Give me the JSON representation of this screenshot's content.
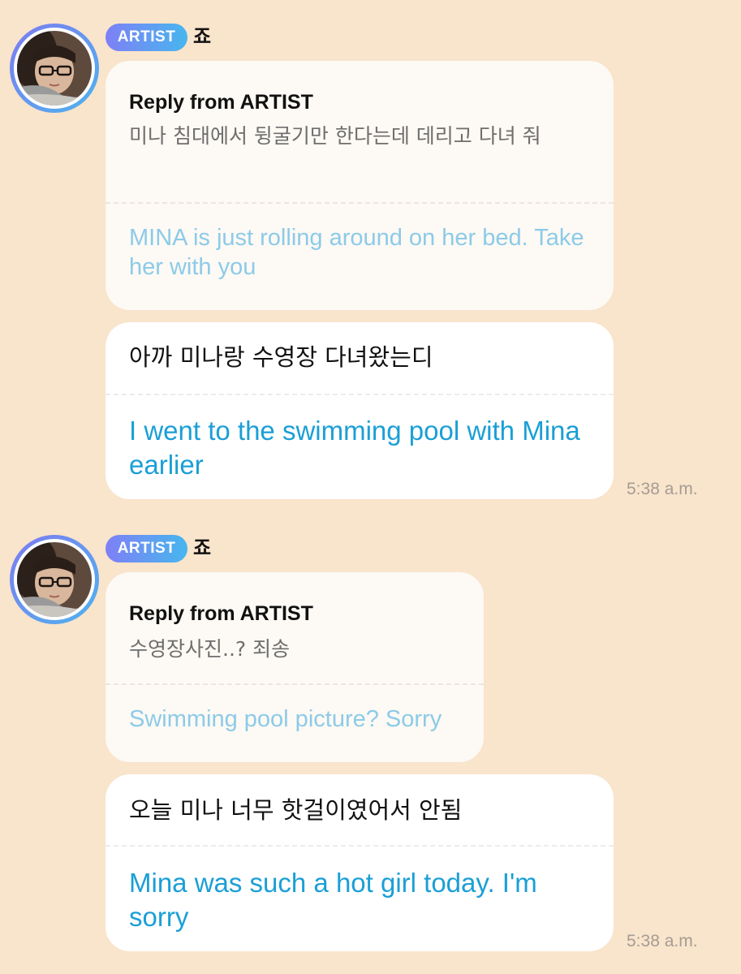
{
  "conversation": [
    {
      "badge": "ARTIST",
      "name": "죠",
      "avatar": "profile-photo",
      "reply": {
        "title": "Reply from ARTIST",
        "original": "미나 침대에서 뒹굴기만 한다는데 데리고 다녀 줘",
        "translation": "MINA is just rolling around on her bed. Take her with you"
      },
      "message": {
        "original": "아까 미나랑 수영장 다녀왔는디",
        "translation": "I went to the swimming pool with Mina earlier"
      },
      "time": "5:38 a.m."
    },
    {
      "badge": "ARTIST",
      "name": "죠",
      "avatar": "profile-photo",
      "reply": {
        "title": "Reply from ARTIST",
        "original": "수영장사진..? 죄송",
        "translation": "Swimming pool picture? Sorry"
      },
      "message": {
        "original": "오늘 미나 너무 핫걸이였어서 안됨",
        "translation": "Mina was such a hot girl today. I'm sorry"
      },
      "time": "5:38 a.m."
    }
  ],
  "colors": {
    "background": "#f9e4cc",
    "badge_start": "#7e80f6",
    "badge_end": "#47b6ee",
    "translation_reply": "#8ccbe8",
    "translation_message": "#1a9fd6"
  }
}
